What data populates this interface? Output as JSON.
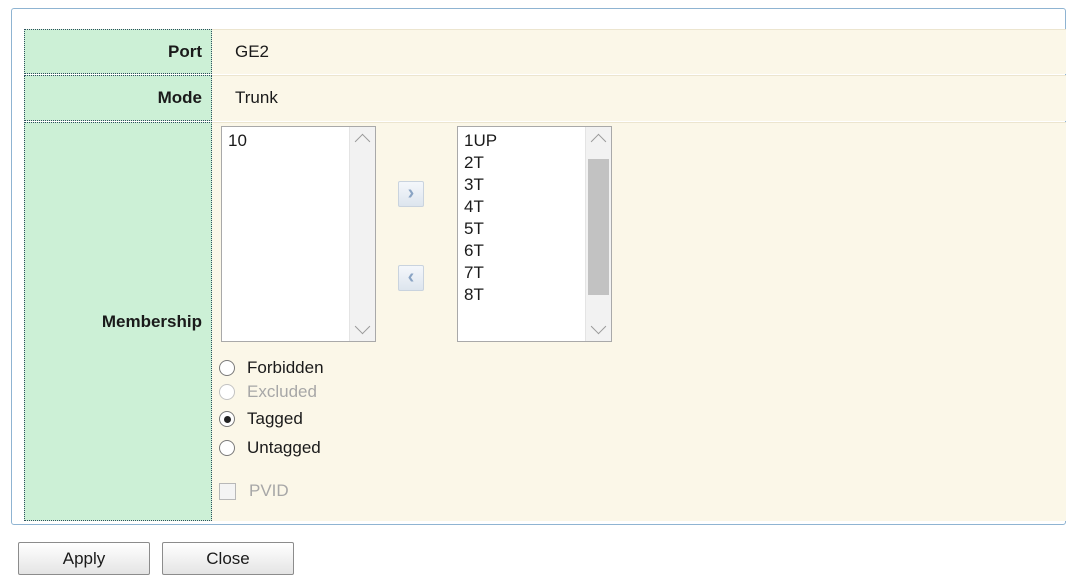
{
  "form": {
    "port_label": "Port",
    "port_value": "GE2",
    "mode_label": "Mode",
    "mode_value": "Trunk",
    "membership_label": "Membership"
  },
  "lists": {
    "available": [
      "10"
    ],
    "selected": [
      "1UP",
      "2T",
      "3T",
      "4T",
      "5T",
      "6T",
      "7T",
      "8T"
    ],
    "add_icon": "chevron-right-icon",
    "remove_icon": "chevron-left-icon"
  },
  "membership_options": [
    {
      "label": "Forbidden",
      "checked": false,
      "disabled": false
    },
    {
      "label": "Excluded",
      "checked": false,
      "disabled": true
    },
    {
      "label": "Tagged",
      "checked": true,
      "disabled": false
    },
    {
      "label": "Untagged",
      "checked": false,
      "disabled": false
    }
  ],
  "pvid": {
    "label": "PVID",
    "checked": false,
    "disabled": true
  },
  "buttons": {
    "apply": "Apply",
    "close": "Close"
  },
  "colors": {
    "label_bg": "#ccf0d6",
    "value_bg": "#fbf7e8",
    "panel_border": "#8fb4d2"
  }
}
